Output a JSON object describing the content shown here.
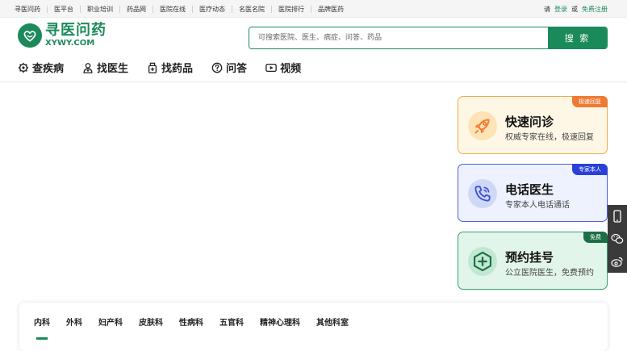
{
  "topbar": {
    "links": [
      "寻医问药",
      "医平台",
      "职业培训",
      "药品网",
      "医院在线",
      "医疗动态",
      "名医名院",
      "医院排行",
      "品牌医药"
    ],
    "login_prefix": "请",
    "login": "登录",
    "or": "或",
    "register": "免费注册"
  },
  "logo": {
    "cn": "寻医问药",
    "en": "XYWY.COM"
  },
  "search": {
    "placeholder": "可搜索医院、医生、病症、问答、药品",
    "button": "搜 索"
  },
  "nav": [
    {
      "label": "查疾病",
      "icon": "gear-icon"
    },
    {
      "label": "找医生",
      "icon": "doctor-icon"
    },
    {
      "label": "找药品",
      "icon": "medicine-icon"
    },
    {
      "label": "问答",
      "icon": "question-icon"
    },
    {
      "label": "视频",
      "icon": "video-icon"
    }
  ],
  "cards": [
    {
      "title": "快速问诊",
      "desc": "权威专家在线，极速回复",
      "badge": "极速回复",
      "icon": "rocket-icon"
    },
    {
      "title": "电话医生",
      "desc": "专家本人电话通话",
      "badge": "专家本人",
      "icon": "phone-icon"
    },
    {
      "title": "预约挂号",
      "desc": "公立医院医生，免费预约",
      "badge": "免费",
      "icon": "plus-icon"
    }
  ],
  "sidebar": [
    "mobile-icon",
    "wechat-icon",
    "weibo-icon"
  ],
  "departments": {
    "tabs": [
      "内科",
      "外科",
      "妇产科",
      "皮肤科",
      "性病科",
      "五官科",
      "精神心理科",
      "其他科室"
    ],
    "active": 0
  },
  "colors": {
    "brand": "#1b8a5a",
    "orange": "#f07a32",
    "blue": "#2a40d8",
    "dark_green": "#1b6e46"
  }
}
